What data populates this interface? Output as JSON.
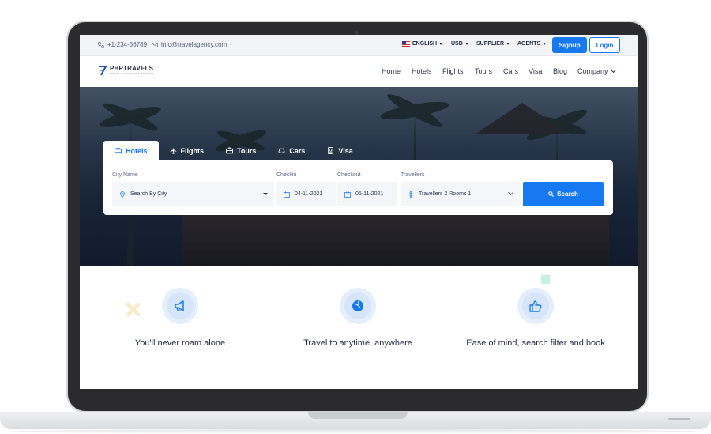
{
  "topbar": {
    "phone": "+1-234-56789",
    "email": "info@travelagency.com",
    "language": "ENGLISH",
    "currency": "USD",
    "supplier": "SUPPLIER",
    "agents": "AGENTS",
    "signup": "Signup",
    "login": "Login"
  },
  "brand": {
    "name": "PHPTRAVELS",
    "tagline": "TRAVEL TECHNOLOGY PARTNER"
  },
  "nav": {
    "items": [
      "Home",
      "Hotels",
      "Flights",
      "Tours",
      "Cars",
      "Visa",
      "Blog",
      "Company"
    ]
  },
  "search": {
    "tabs": [
      {
        "label": "Hotels",
        "icon": "hotel-icon",
        "active": true
      },
      {
        "label": "Flights",
        "icon": "plane-icon",
        "active": false
      },
      {
        "label": "Tours",
        "icon": "briefcase-icon",
        "active": false
      },
      {
        "label": "Cars",
        "icon": "car-icon",
        "active": false
      },
      {
        "label": "Visa",
        "icon": "passport-icon",
        "active": false
      }
    ],
    "city_label": "City Name",
    "city_value": "Search By City",
    "checkin_label": "Checkin",
    "checkin_value": "04-11-2021",
    "checkout_label": "Checkout",
    "checkout_value": "05-11-2021",
    "travellers_label": "Travellers",
    "travellers_value": "Travellers 2 Rooms 1",
    "button": "Search"
  },
  "features": [
    {
      "title": "You'll never roam alone",
      "icon": "megaphone-icon"
    },
    {
      "title": "Travel to anytime, anywhere",
      "icon": "globe-icon"
    },
    {
      "title": "Ease of mind, search filter and book",
      "icon": "thumbs-up-icon"
    }
  ],
  "colors": {
    "accent": "#1779f2",
    "text_dark": "#1f2b45",
    "topbar_bg": "#f1f3f7",
    "feature_circle": "#e5eefb"
  }
}
